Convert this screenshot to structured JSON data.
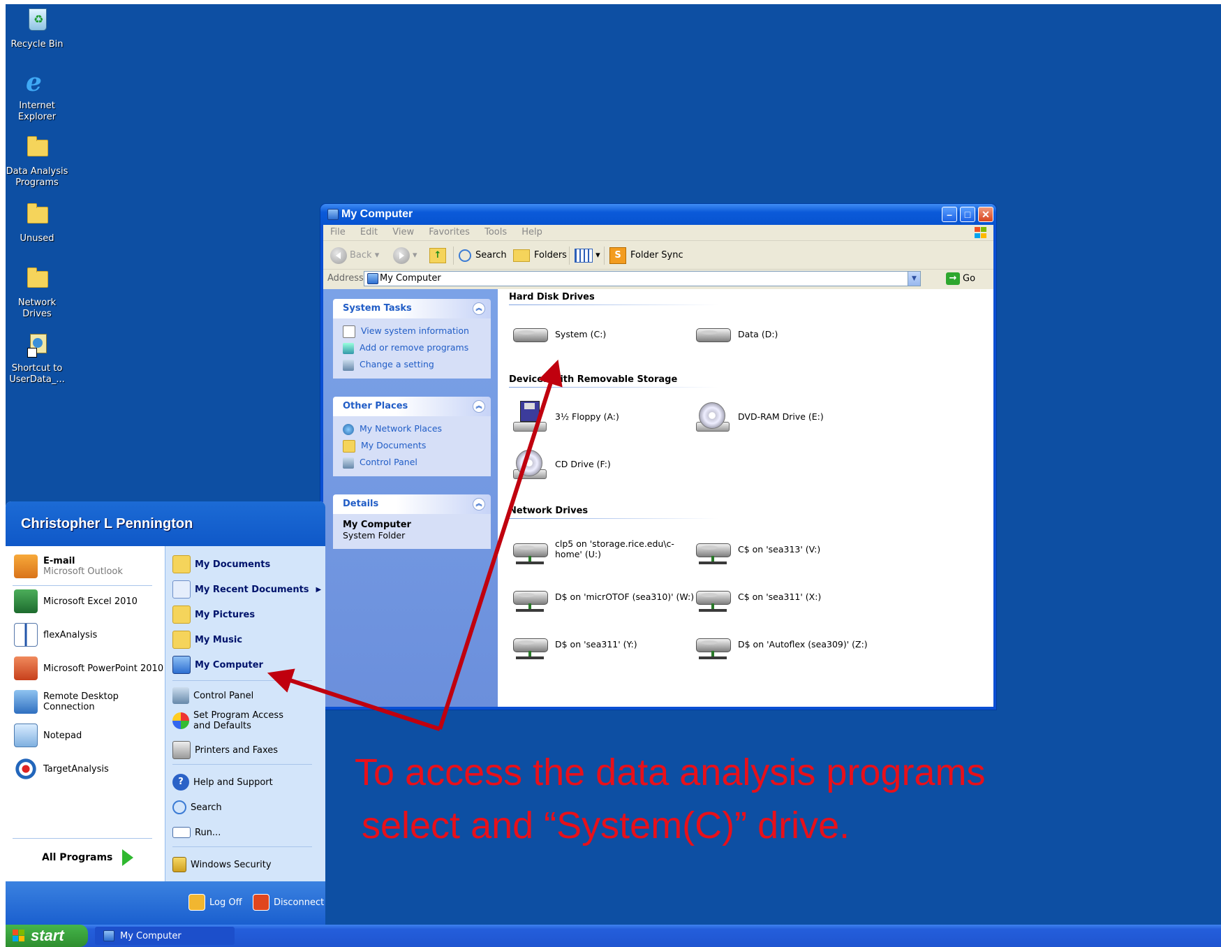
{
  "desktop": {
    "icons": [
      {
        "label": "Recycle Bin",
        "icon": "recycle-bin-icon"
      },
      {
        "label": "Internet Explorer",
        "icon": "internet-explorer-icon"
      },
      {
        "label": "Data Analysis Programs",
        "icon": "folder-icon"
      },
      {
        "label": "Unused",
        "icon": "folder-icon"
      },
      {
        "label": "Network Drives",
        "icon": "folder-icon"
      },
      {
        "label": "Shortcut to UserData_...",
        "icon": "shortcut-icon"
      }
    ]
  },
  "window": {
    "title": "My Computer",
    "menu": [
      "File",
      "Edit",
      "View",
      "Favorites",
      "Tools",
      "Help"
    ],
    "toolbar": {
      "back": "Back",
      "search": "Search",
      "folders": "Folders",
      "folder_sync": "Folder Sync"
    },
    "address": {
      "label": "Address",
      "value": "My Computer",
      "go": "Go"
    },
    "system_tasks": {
      "title": "System Tasks",
      "items": [
        "View system information",
        "Add or remove programs",
        "Change a setting"
      ]
    },
    "other_places": {
      "title": "Other Places",
      "items": [
        "My Network Places",
        "My Documents",
        "Control Panel"
      ]
    },
    "details": {
      "title": "Details",
      "name": "My Computer",
      "type": "System Folder"
    },
    "groups": {
      "hard_disk": {
        "title": "Hard Disk Drives",
        "drives": [
          "System (C:)",
          "Data (D:)"
        ]
      },
      "removable": {
        "title": "Devices with Removable Storage",
        "drives": [
          "3½ Floppy (A:)",
          "DVD-RAM Drive (E:)",
          "CD Drive (F:)"
        ]
      },
      "network": {
        "title": "Network Drives",
        "drives": [
          "clp5 on 'storage.rice.edu\\c-home' (U:)",
          "C$ on 'sea313' (V:)",
          "D$ on 'micrOTOF (sea310)' (W:)",
          "C$ on 'sea311' (X:)",
          "D$ on 'sea311' (Y:)",
          "D$ on 'Autoflex (sea309)' (Z:)"
        ]
      }
    }
  },
  "start_menu": {
    "user": "Christopher L Pennington",
    "pinned": [
      {
        "title": "E-mail",
        "subtitle": "Microsoft Outlook"
      }
    ],
    "programs": [
      "Microsoft Excel 2010",
      "flexAnalysis",
      "Microsoft PowerPoint 2010",
      "Remote Desktop Connection",
      "Notepad",
      "TargetAnalysis"
    ],
    "all_programs": "All Programs",
    "right_bold": [
      "My Documents",
      "My Recent Documents",
      "My Pictures",
      "My Music",
      "My Computer"
    ],
    "right_items": [
      "Control Panel",
      "Set Program Access and Defaults",
      "Printers and Faxes",
      "Help and Support",
      "Search",
      "Run...",
      "Windows Security"
    ],
    "log_off": "Log Off",
    "disconnect": "Disconnect"
  },
  "taskbar": {
    "start": "start",
    "task": "My Computer"
  },
  "annotation": {
    "line1": "To access the data analysis programs",
    "line2": "select  and “System(C)” drive."
  },
  "colors": {
    "desktop": "#0d4fa3",
    "annotation": "#e8101a",
    "arrow": "#c0000e"
  }
}
